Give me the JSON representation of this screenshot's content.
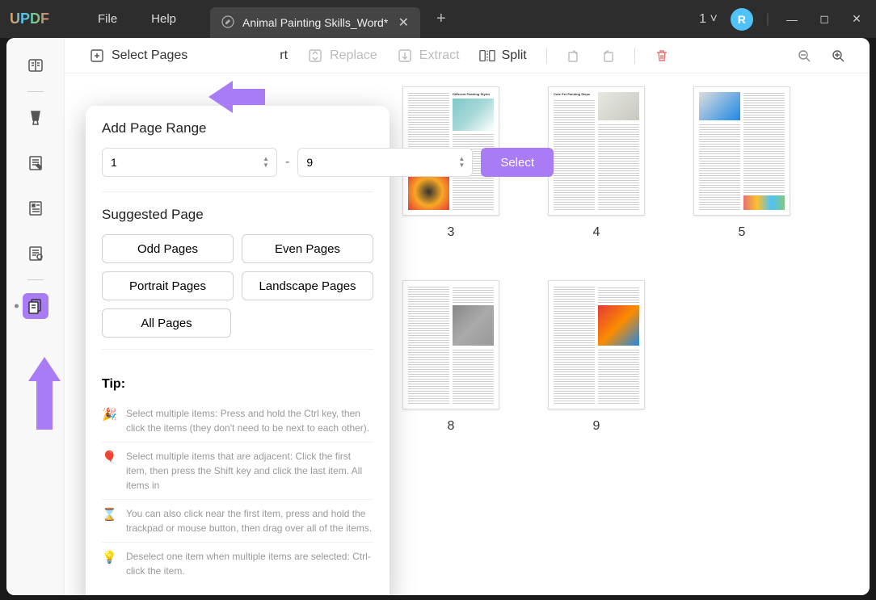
{
  "titlebar": {
    "logo": "UPDF",
    "menus": {
      "file": "File",
      "help": "Help"
    },
    "tab_title": "Animal Painting Skills_Word*",
    "tab_count": "1",
    "avatar": "R"
  },
  "toolbar": {
    "select_pages": "Select Pages",
    "insert": "rt",
    "replace": "Replace",
    "extract": "Extract",
    "split": "Split"
  },
  "popover": {
    "range_title": "Add Page Range",
    "from": "1",
    "to": "9",
    "select_btn": "Select",
    "suggest_title": "Suggested Page",
    "odd": "Odd Pages",
    "even": "Even Pages",
    "portrait": "Portrait Pages",
    "landscape": "Landscape Pages",
    "all": "All Pages",
    "tip_title": "Tip:",
    "tips": [
      "Select multiple items: Press and hold the Ctrl key, then click the items (they don't need to be next to each other).",
      "Select multiple items that are adjacent: Click the first item, then press the Shift key and click the last item. All items in",
      "You can also click near the first item, press and hold the trackpad or mouse button, then drag over all of the items.",
      "Deselect one item when multiple items are selected: Ctrl-click the item."
    ]
  },
  "thumbs": {
    "p3_title": "Different Painting Styles",
    "p4_title": "Cute Pet Painting Steps",
    "nums": {
      "n3": "3",
      "n4": "4",
      "n5": "5",
      "n8": "8",
      "n9": "9"
    }
  }
}
